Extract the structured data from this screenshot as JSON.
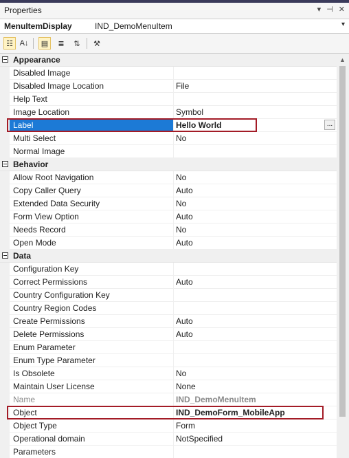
{
  "window": {
    "title": "Properties"
  },
  "object_bar": {
    "type": "MenuItemDisplay",
    "name": "IND_DemoMenuItem"
  },
  "toolbar": {
    "buttons": [
      {
        "name": "categorized-view-button",
        "icon": "categorized-icon",
        "glyph": "☷",
        "active": true
      },
      {
        "name": "alphabetical-view-button",
        "icon": "sort-az-icon",
        "glyph": "A↓",
        "active": false
      },
      {
        "name": "property-pages-button",
        "icon": "property-pages-icon",
        "glyph": "▤",
        "active": true
      },
      {
        "name": "events-button",
        "icon": "events-icon",
        "glyph": "≣",
        "active": false
      },
      {
        "name": "sort-button",
        "icon": "sort-icon",
        "glyph": "⇅",
        "active": false
      },
      {
        "name": "wrench-button",
        "icon": "wrench-icon",
        "glyph": "⚒",
        "active": false
      }
    ]
  },
  "grid": {
    "rows": [
      {
        "kind": "cat",
        "name": "Appearance"
      },
      {
        "kind": "prop",
        "name": "Disabled Image",
        "value": ""
      },
      {
        "kind": "prop",
        "name": "Disabled Image Location",
        "value": "File"
      },
      {
        "kind": "prop",
        "name": "Help Text",
        "value": ""
      },
      {
        "kind": "prop",
        "name": "Image Location",
        "value": "Symbol"
      },
      {
        "kind": "prop",
        "name": "Label",
        "value": "Hello World",
        "selected": true,
        "bold": true,
        "ellipsis": true
      },
      {
        "kind": "prop",
        "name": "Multi Select",
        "value": "No"
      },
      {
        "kind": "prop",
        "name": "Normal Image",
        "value": ""
      },
      {
        "kind": "cat",
        "name": "Behavior"
      },
      {
        "kind": "prop",
        "name": "Allow Root Navigation",
        "value": "No"
      },
      {
        "kind": "prop",
        "name": "Copy Caller Query",
        "value": "Auto"
      },
      {
        "kind": "prop",
        "name": "Extended Data Security",
        "value": "No"
      },
      {
        "kind": "prop",
        "name": "Form View Option",
        "value": "Auto"
      },
      {
        "kind": "prop",
        "name": "Needs Record",
        "value": "No"
      },
      {
        "kind": "prop",
        "name": "Open Mode",
        "value": "Auto"
      },
      {
        "kind": "cat",
        "name": "Data"
      },
      {
        "kind": "prop",
        "name": "Configuration Key",
        "value": ""
      },
      {
        "kind": "prop",
        "name": "Correct Permissions",
        "value": "Auto"
      },
      {
        "kind": "prop",
        "name": "Country Configuration Key",
        "value": ""
      },
      {
        "kind": "prop",
        "name": "Country Region Codes",
        "value": ""
      },
      {
        "kind": "prop",
        "name": "Create Permissions",
        "value": "Auto"
      },
      {
        "kind": "prop",
        "name": "Delete Permissions",
        "value": "Auto"
      },
      {
        "kind": "prop",
        "name": "Enum Parameter",
        "value": ""
      },
      {
        "kind": "prop",
        "name": "Enum Type Parameter",
        "value": ""
      },
      {
        "kind": "prop",
        "name": "Is Obsolete",
        "value": "No"
      },
      {
        "kind": "prop",
        "name": "Maintain User License",
        "value": "None"
      },
      {
        "kind": "prop",
        "name": "Name",
        "value": "IND_DemoMenuItem",
        "dim": true,
        "bold": true
      },
      {
        "kind": "prop",
        "name": "Object",
        "value": "IND_DemoForm_MobileApp",
        "bold": true
      },
      {
        "kind": "prop",
        "name": "Object Type",
        "value": "Form"
      },
      {
        "kind": "prop",
        "name": "Operational domain",
        "value": "NotSpecified"
      },
      {
        "kind": "prop",
        "name": "Parameters",
        "value": ""
      }
    ]
  },
  "colors": {
    "selection": "#1c7ad6",
    "highlight_border": "#a31b26",
    "toolbar_active": "#fff3c4"
  }
}
